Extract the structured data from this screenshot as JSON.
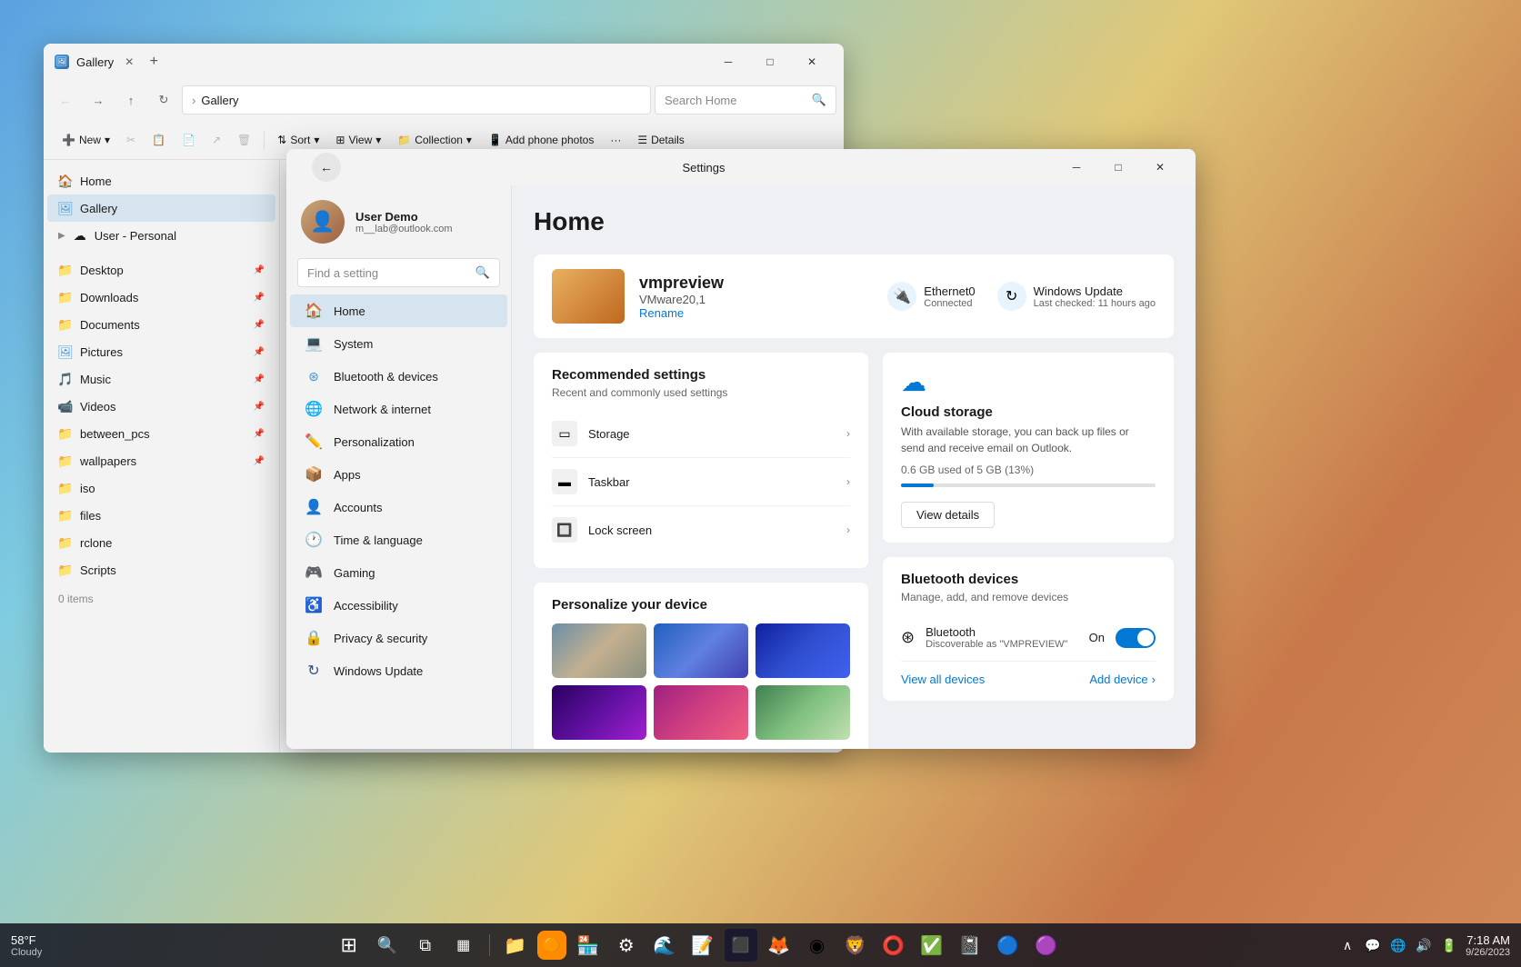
{
  "explorer": {
    "title": "Gallery",
    "tab_label": "Gallery",
    "search_placeholder": "Search Home",
    "address": "Gallery",
    "toolbar": {
      "new_label": "New",
      "sort_label": "Sort",
      "view_label": "View",
      "collection_label": "Collection",
      "add_phone_label": "Add phone photos",
      "details_label": "Details"
    },
    "sidebar": {
      "home_label": "Home",
      "gallery_label": "Gallery",
      "user_personal_label": "User - Personal",
      "items": [
        {
          "label": "Desktop",
          "pinned": true
        },
        {
          "label": "Downloads",
          "pinned": true
        },
        {
          "label": "Documents",
          "pinned": true
        },
        {
          "label": "Pictures",
          "pinned": true
        },
        {
          "label": "Music",
          "pinned": true
        },
        {
          "label": "Videos",
          "pinned": true
        },
        {
          "label": "between_pcs",
          "pinned": true
        },
        {
          "label": "wallpapers",
          "pinned": true
        },
        {
          "label": "iso",
          "pinned": false
        },
        {
          "label": "files",
          "pinned": false
        },
        {
          "label": "rclone",
          "pinned": false
        },
        {
          "label": "Scripts",
          "pinned": false
        }
      ]
    },
    "items_count": "0 items"
  },
  "settings": {
    "title": "Settings",
    "page_title": "Home",
    "back_label": "←",
    "user": {
      "name": "User Demo",
      "email": "m__lab@outlook.com"
    },
    "search_placeholder": "Find a setting",
    "nav": [
      {
        "id": "home",
        "label": "Home",
        "icon": "🏠"
      },
      {
        "id": "system",
        "label": "System",
        "icon": "💻"
      },
      {
        "id": "bluetooth",
        "label": "Bluetooth & devices",
        "icon": "◈"
      },
      {
        "id": "network",
        "label": "Network & internet",
        "icon": "🌐"
      },
      {
        "id": "personalization",
        "label": "Personalization",
        "icon": "✏️"
      },
      {
        "id": "apps",
        "label": "Apps",
        "icon": "📦"
      },
      {
        "id": "accounts",
        "label": "Accounts",
        "icon": "👤"
      },
      {
        "id": "time",
        "label": "Time & language",
        "icon": "🕐"
      },
      {
        "id": "gaming",
        "label": "Gaming",
        "icon": "🎮"
      },
      {
        "id": "accessibility",
        "label": "Accessibility",
        "icon": "♿"
      },
      {
        "id": "privacy",
        "label": "Privacy & security",
        "icon": "🔒"
      },
      {
        "id": "update",
        "label": "Windows Update",
        "icon": "↻"
      }
    ],
    "device": {
      "name": "vmpreview",
      "model": "VMware20,1",
      "rename_label": "Rename",
      "ethernet_label": "Ethernet0",
      "ethernet_status": "Connected",
      "update_label": "Windows Update",
      "update_status": "Last checked: 11 hours ago"
    },
    "recommended": {
      "title": "Recommended settings",
      "subtitle": "Recent and commonly used settings",
      "items": [
        {
          "label": "Storage",
          "icon": "▭"
        },
        {
          "label": "Taskbar",
          "icon": "▬"
        },
        {
          "label": "Lock screen",
          "icon": "🔲"
        }
      ]
    },
    "personalize": {
      "title": "Personalize your device"
    },
    "cloud_storage": {
      "title": "Cloud storage",
      "description": "With available storage, you can back up files or send and receive email on Outlook.",
      "used": "0.6 GB",
      "total": "5 GB",
      "percent": "13%",
      "bar_percent": 13,
      "view_details_label": "View details"
    },
    "bluetooth_devices": {
      "title": "Bluetooth devices",
      "subtitle": "Manage, add, and remove devices",
      "bluetooth_label": "Bluetooth",
      "bluetooth_sub": "Discoverable as \"VMPREVIEW\"",
      "on_label": "On",
      "view_all_label": "View all devices",
      "add_device_label": "Add device"
    }
  },
  "taskbar": {
    "weather": {
      "temp": "58°F",
      "condition": "Cloudy"
    },
    "clock": {
      "time": "7:18 AM",
      "date": "9/26/2023"
    },
    "icons": [
      {
        "id": "start",
        "glyph": "⊞"
      },
      {
        "id": "search",
        "glyph": "🔍"
      },
      {
        "id": "taskview",
        "glyph": "⧉"
      },
      {
        "id": "widgets",
        "glyph": "▦"
      },
      {
        "id": "explorer",
        "glyph": "📁"
      },
      {
        "id": "orange",
        "glyph": "🟠"
      },
      {
        "id": "msstore",
        "glyph": "🏪"
      },
      {
        "id": "settings",
        "glyph": "⚙"
      },
      {
        "id": "edge",
        "glyph": "🌊"
      },
      {
        "id": "vscode",
        "glyph": "📝"
      },
      {
        "id": "terminal",
        "glyph": "⬛"
      },
      {
        "id": "firefox",
        "glyph": "🦊"
      },
      {
        "id": "chrome",
        "glyph": "◉"
      },
      {
        "id": "brave",
        "glyph": "🦁"
      },
      {
        "id": "opera",
        "glyph": "🎭"
      },
      {
        "id": "todoist",
        "glyph": "✅"
      },
      {
        "id": "onenote",
        "glyph": "📓"
      },
      {
        "id": "unknown1",
        "glyph": "🔵"
      },
      {
        "id": "unknown2",
        "glyph": "🟣"
      }
    ],
    "tray": {
      "chevron_glyph": "∧",
      "msg_glyph": "💬",
      "network_glyph": "🌐",
      "volume_glyph": "🔊",
      "battery_glyph": "🔋"
    }
  }
}
